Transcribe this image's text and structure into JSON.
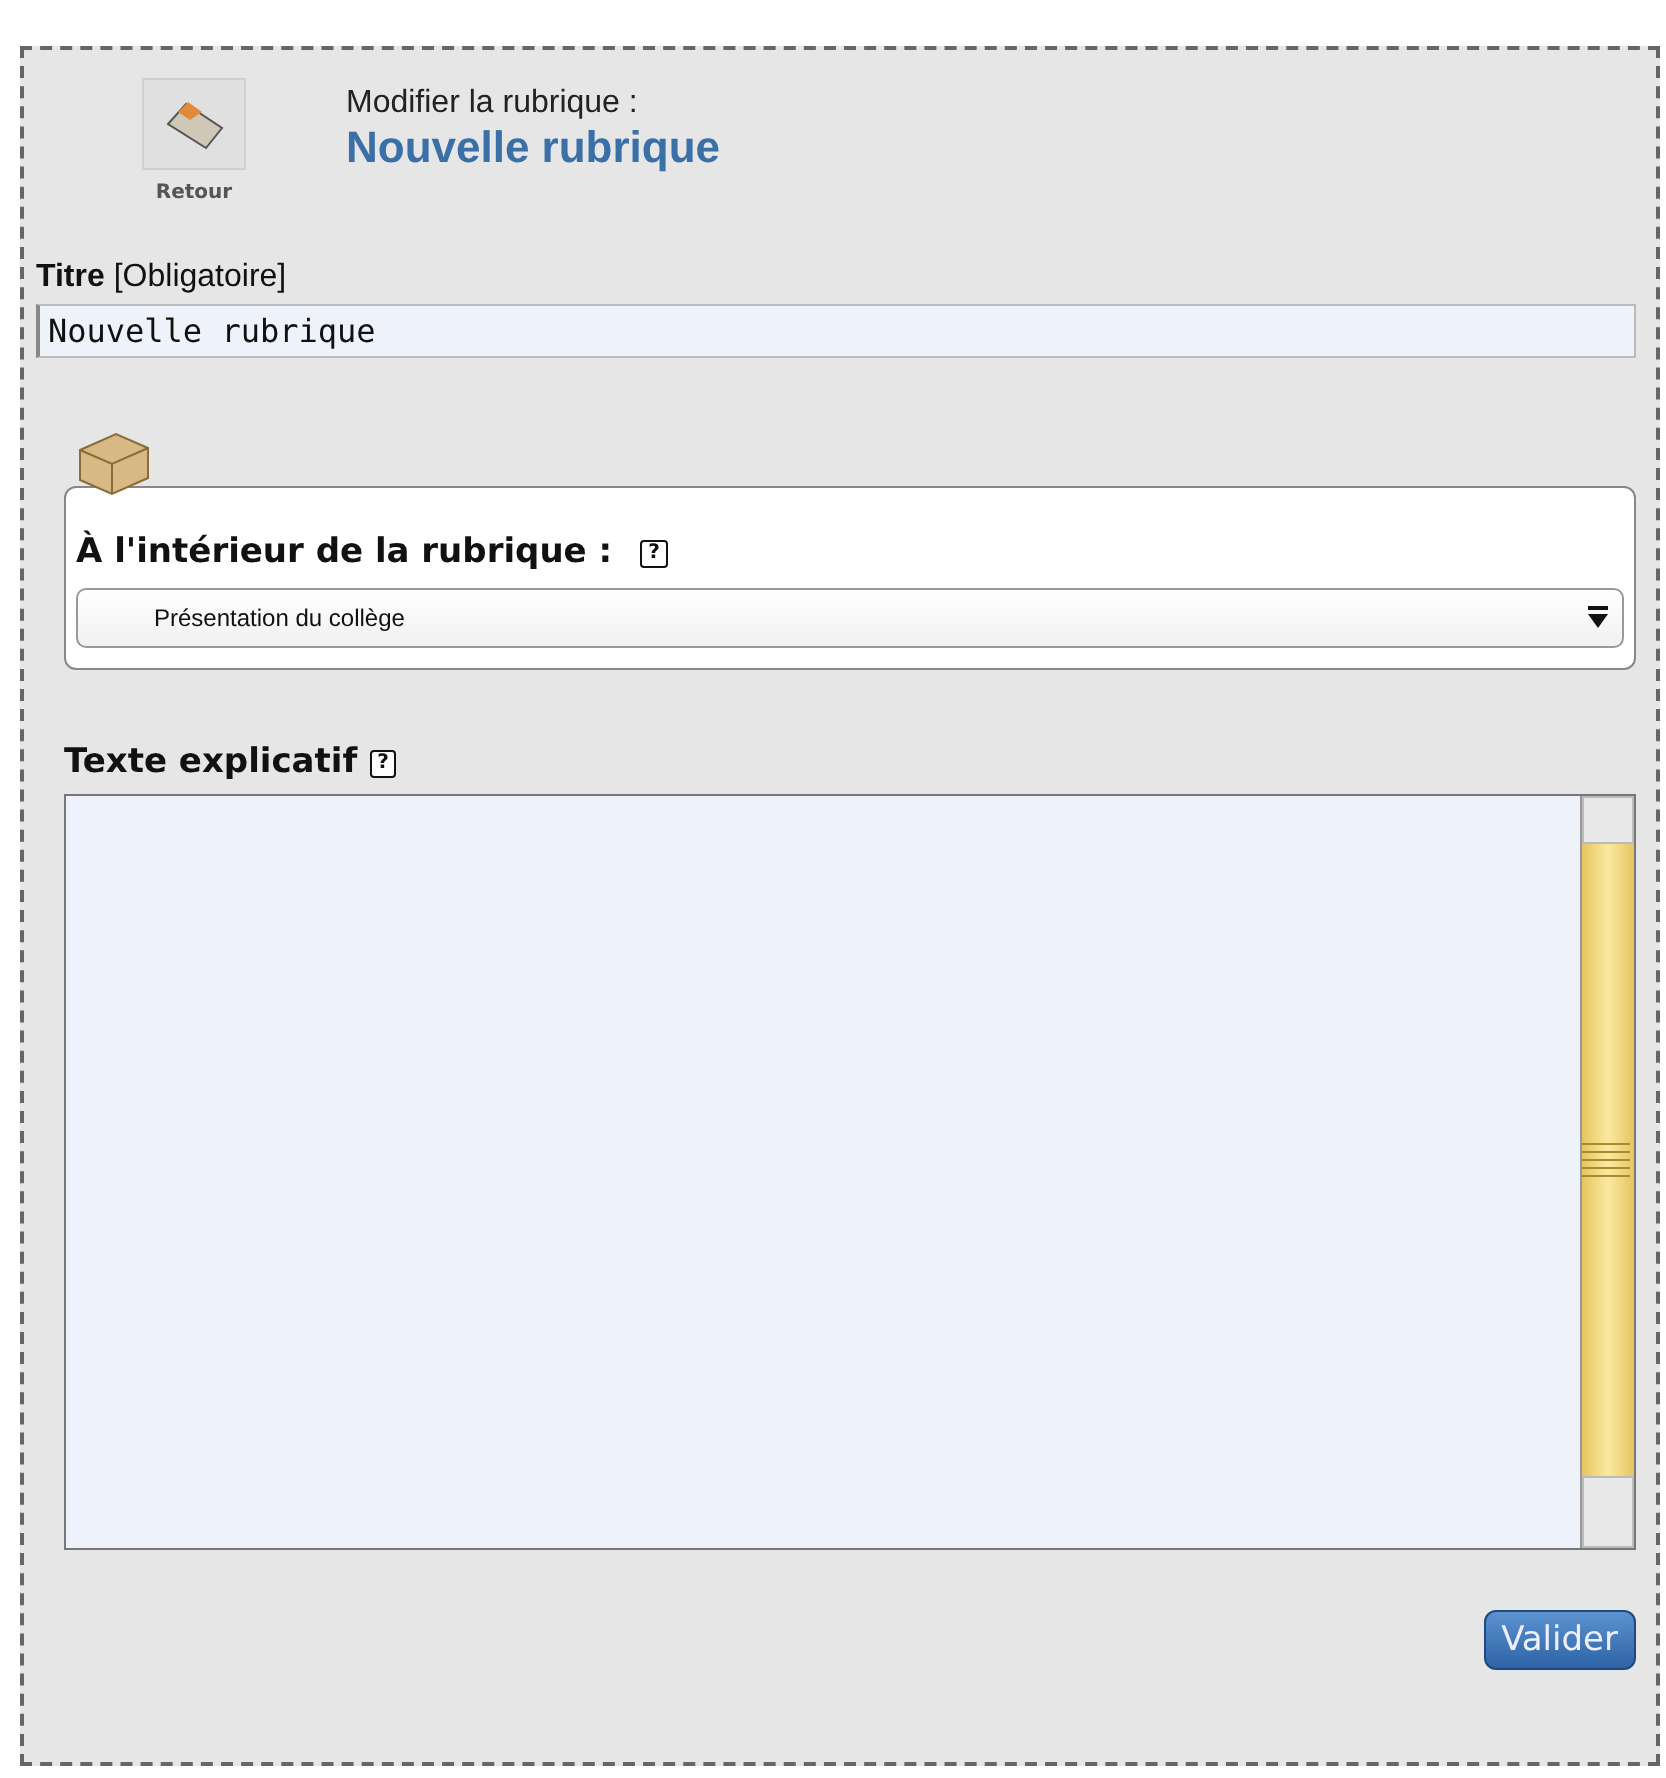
{
  "header": {
    "back_label": "Retour",
    "subtitle": "Modifier la rubrique :",
    "title": "Nouvelle rubrique"
  },
  "title_field": {
    "label": "Titre",
    "hint": "[Obligatoire]",
    "value": "Nouvelle rubrique"
  },
  "parent_section": {
    "label": "À l'intérieur de la rubrique :",
    "help": "?",
    "selected_value": "Présentation du collège"
  },
  "description": {
    "label": "Texte explicatif",
    "help": "?"
  },
  "buttons": [
    "Valider"
  ]
}
